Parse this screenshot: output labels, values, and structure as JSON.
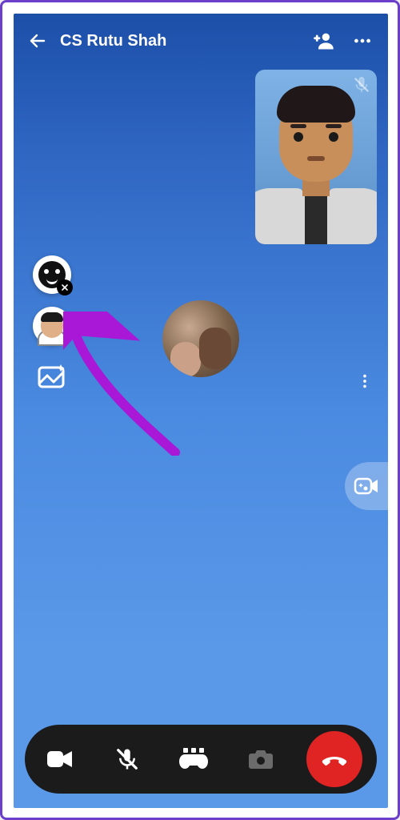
{
  "header": {
    "title": "CS Rutu Shah"
  },
  "pip": {
    "muted": true
  },
  "side": {
    "avatars_label": "avatars",
    "mini_avatar_label": "avatar-effect",
    "effects_label": "photo-effects"
  },
  "bottom": {
    "camera": "camera",
    "mic": "mic-muted",
    "games": "games",
    "capture": "capture",
    "end": "end-call"
  }
}
